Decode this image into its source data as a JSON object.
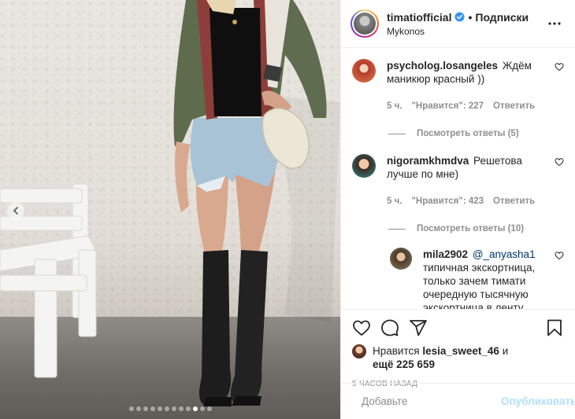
{
  "post": {
    "username": "timatiofficial",
    "follow_label": "Подписки",
    "bullet": "•",
    "location": "Mykonos",
    "more_icon": "ellipsis-icon"
  },
  "carousel": {
    "total": 12,
    "active": 10
  },
  "comments": [
    {
      "user": "psycholog.losangeles",
      "text": "Ждём маникюр красный ))",
      "time": "5 ч.",
      "likes": "\"Нравится\": 227",
      "reply": "Ответить",
      "view_replies": "Посмотреть ответы (5)"
    },
    {
      "user": "nigoramkhmdva",
      "text": "Решетова лучше по мне)",
      "time": "5 ч.",
      "likes": "\"Нравится\": 423",
      "reply": "Ответить",
      "view_replies": "Посмотреть ответы (10)"
    }
  ],
  "reply": {
    "user": "mila2902",
    "mention": "@_anyasha1",
    "text": "типичная экскортница, только зачем тимати очередную тысячную экскортница в ленту"
  },
  "actions": {
    "liked_by_prefix": "Нравится",
    "liked_by_user": "lesia_sweet_46",
    "liked_by_and": "и",
    "liked_by_more": "ещё 225 659",
    "timestamp": "5 ЧАСОВ НАЗАД"
  },
  "add_comment": {
    "placeholder": "Добавьте",
    "publish_label": "Опубликовать"
  },
  "colors": {
    "verified": "#3897f0",
    "publish_disabled": "#b2dffc",
    "muted": "#8e8e8e",
    "mention": "#00376b"
  }
}
